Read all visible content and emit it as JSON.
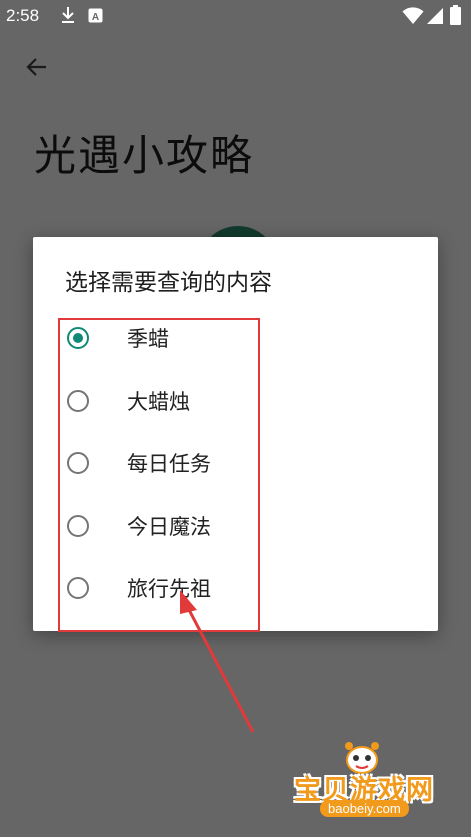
{
  "status_bar": {
    "time": "2:58",
    "icons": [
      "download-icon",
      "keyboard-a-icon",
      "wifi-icon",
      "signal-icon",
      "battery-icon"
    ]
  },
  "app_bar": {
    "back_icon": "arrow-left-icon",
    "title": "光遇小攻略"
  },
  "dialog": {
    "title": "选择需要查询的内容",
    "selected_index": 0,
    "options": [
      {
        "label": "季蜡",
        "checked": true
      },
      {
        "label": "大蜡烛",
        "checked": false
      },
      {
        "label": "每日任务",
        "checked": false
      },
      {
        "label": "今日魔法",
        "checked": false
      },
      {
        "label": "旅行先祖",
        "checked": false
      }
    ],
    "accent_color": "#0f8a76"
  },
  "annotation": {
    "color": "#e03a3a"
  },
  "watermark": {
    "main": "宝贝游戏网",
    "sub": "baobeiy.com"
  }
}
